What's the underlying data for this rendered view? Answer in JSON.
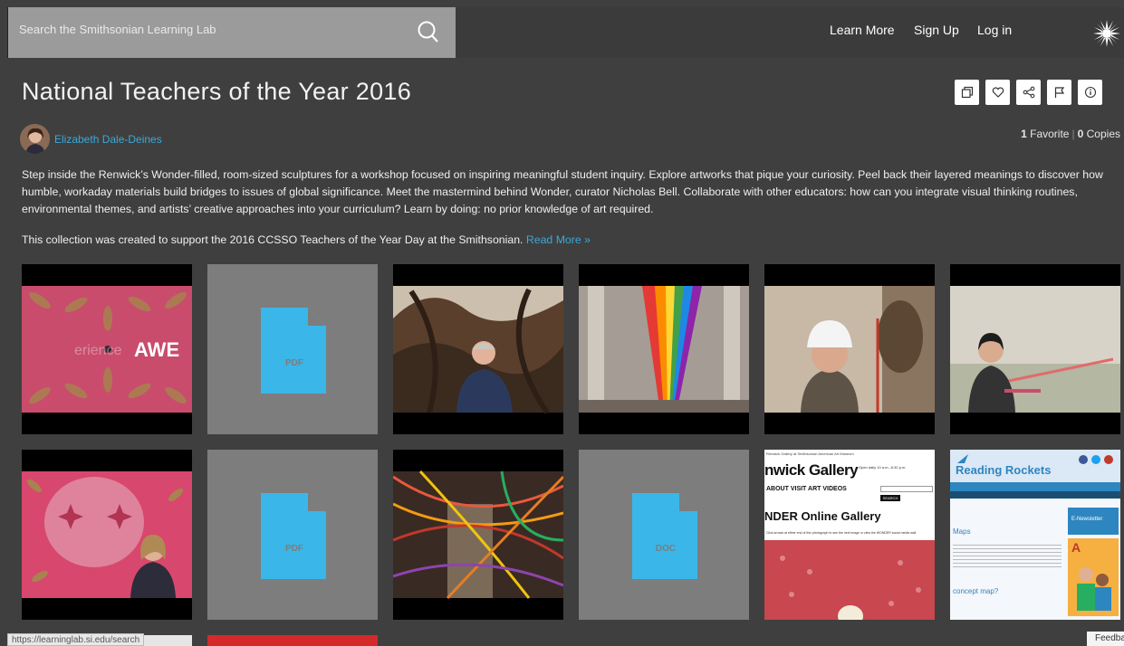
{
  "header": {
    "search_placeholder": "Search the Smithsonian Learning Lab",
    "nav": [
      "Learn More",
      "Sign Up",
      "Log in"
    ]
  },
  "collection": {
    "title": "National Teachers of the Year 2016",
    "author": "Elizabeth Dale-Deines",
    "favorites_count": "1",
    "favorites_label": "Favorite",
    "copies_count": "0",
    "copies_label": "Copies",
    "description": "Step inside the Renwick’s Wonder-filled, room-sized sculptures for a workshop focused on inspiring meaningful student inquiry. Explore artworks that pique your curiosity. Peel back their layered meanings to discover how humble, workaday materials build bridges to issues of global significance. Meet the mastermind behind Wonder, curator Nicholas Bell. Collaborate with other educators: how can you integrate visual thinking routines, environmental themes, and artists’ creative approaches into your curriculum? Learn by doing: no prior knowledge of art required.",
    "description2": "This collection was created to support the 2016 CCSSO Teachers of the Year Day at the Smithsonian.",
    "read_more": "Read More »"
  },
  "actions": [
    "copy-icon",
    "heart-icon",
    "share-icon",
    "flag-icon",
    "info-icon"
  ],
  "tiles": {
    "pdf_label": "PDF",
    "doc_label": "DOC",
    "t1_text": "AWE",
    "t1_ghost": "erience",
    "renwick": {
      "header_small": "Renwick Gallery at Smithsonian American Art Museum",
      "title": "nwick Gallery",
      "open_text": "Open daily 10 a.m.–5:30 p.m.",
      "nav": "ABOUT  VISIT  ART  VIDEOS",
      "search": "SEARCH",
      "subtitle": "NDER Online Gallery",
      "caption": "Click arrows at either end of this photograph to see the next image or view the WONDER social media wall"
    },
    "rockets": {
      "title": "Reading Rockets",
      "section": "Maps",
      "sub": "concept map?",
      "banner": "A",
      "signup": "E-Newsletter"
    }
  },
  "colors": {
    "background": "#3f3f3f",
    "link": "#3aa9d9",
    "doc_blue": "#3bb6e8"
  },
  "status": {
    "url": "https://learninglab.si.edu/search",
    "feedback": "Feedback"
  }
}
